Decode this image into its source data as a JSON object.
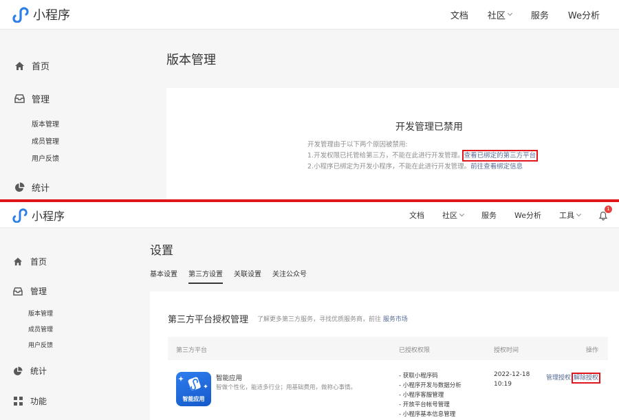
{
  "top": {
    "header": {
      "logo_text": "小程序",
      "nav": [
        "文档",
        "社区",
        "服务",
        "We分析"
      ]
    },
    "sidebar": {
      "home": "首页",
      "manage": "管理",
      "sub": [
        "版本管理",
        "成员管理",
        "用户反馈"
      ],
      "stats": "统计"
    },
    "page_title": "版本管理",
    "notice": {
      "title": "开发管理已禁用",
      "intro": "开发管理由于以下两个原因被禁用:",
      "reason1_text": "1.开发权限已托管给第三方，不能在此进行开发管理。",
      "reason1_link": "查看已绑定的第三方平台",
      "reason2_text": "2.小程序已绑定为开发小程序，不能在此进行开发管理。",
      "reason2_link": "前往查看绑定信息"
    }
  },
  "bottom": {
    "header": {
      "logo_text": "小程序",
      "nav": [
        "文档",
        "社区",
        "服务",
        "We分析",
        "工具"
      ],
      "badge": "1"
    },
    "sidebar": {
      "home": "首页",
      "manage": "管理",
      "sub": [
        "版本管理",
        "成员管理",
        "用户反馈"
      ],
      "stats": "统计",
      "features": "功能"
    },
    "page_title": "设置",
    "tabs": [
      "基本设置",
      "第三方设置",
      "关联设置",
      "关注公众号"
    ],
    "active_tab": "第三方设置",
    "section": {
      "title": "第三方平台授权管理",
      "note": "了解更多第三方服务，寻找优质服务商，前往",
      "note_link": "服务市场"
    },
    "table": {
      "headers": [
        "第三方平台",
        "已授权权限",
        "授权时间",
        "操作"
      ],
      "row": {
        "icon_label": "智能应用",
        "name": "智能应用",
        "desc": "智做个性化，能适多行业；用基础费用，做称心事情。",
        "permissions": [
          "- 获取小程序码",
          "- 小程序开发与数据分析",
          "- 小程序客服管理",
          "- 开放平台帐号管理",
          "- 小程序基本信息管理"
        ],
        "date": "2022-12-18",
        "time": "10:19",
        "op_manage": "管理授权",
        "op_revoke": "解除授权"
      }
    }
  }
}
